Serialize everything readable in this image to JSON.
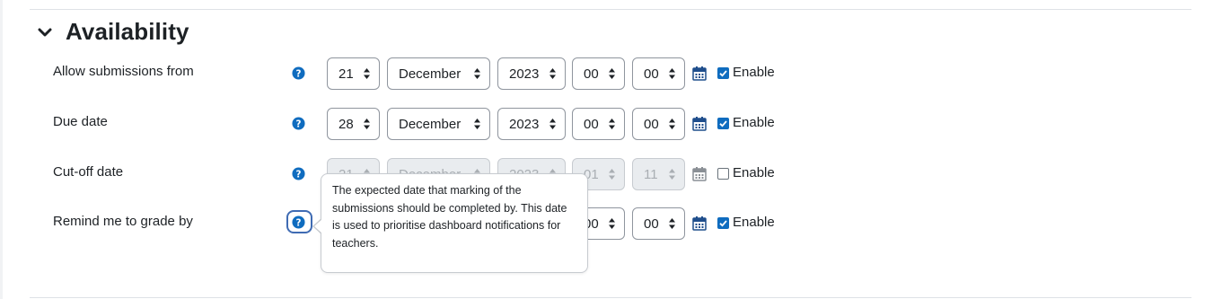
{
  "section": {
    "title": "Availability",
    "icon": "chevron-down-icon"
  },
  "month_text": "December",
  "enable_label": "Enable",
  "rows": [
    {
      "label": "Allow submissions from",
      "day": "21",
      "month": "December",
      "year": "2023",
      "hour": "00",
      "minute": "00",
      "enabled": true
    },
    {
      "label": "Due date",
      "day": "28",
      "month": "December",
      "year": "2023",
      "hour": "00",
      "minute": "00",
      "enabled": true
    },
    {
      "label": "Cut-off date",
      "day": "21",
      "month": "December",
      "year": "2023",
      "hour": "01",
      "minute": "11",
      "enabled": false
    },
    {
      "label": "Remind me to grade by",
      "day": "",
      "month": "",
      "year": "",
      "hour": "00",
      "minute": "00",
      "enabled": true
    }
  ],
  "tooltip": {
    "text": "The expected date that marking of the submissions should be completed by. This date is used to prioritise dashboard notifications for teachers."
  },
  "colors": {
    "accent": "#0f6cbf",
    "help_icon": "#0f6cbf",
    "focus_ring": "#3f6bb3",
    "calendar_icon": "#1f4e8c"
  }
}
